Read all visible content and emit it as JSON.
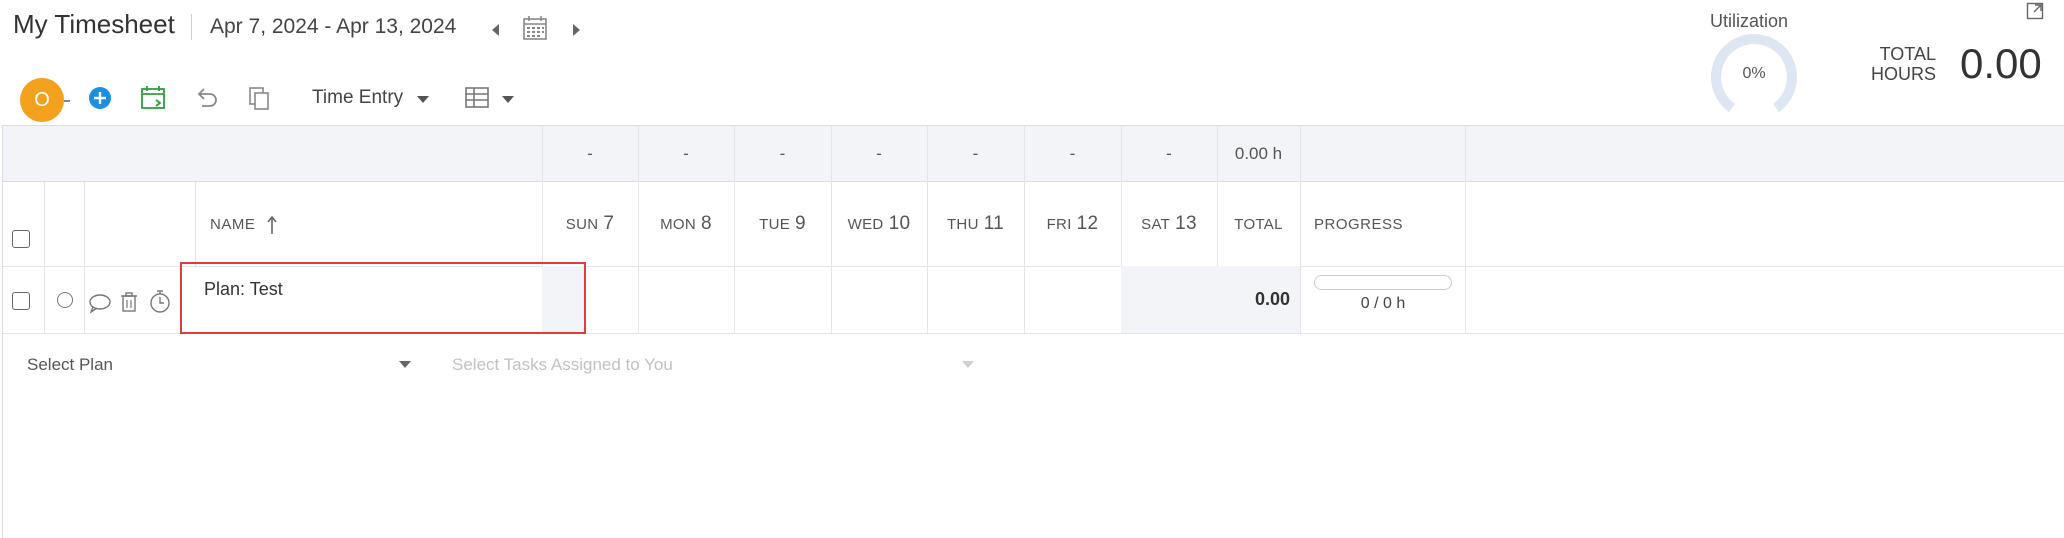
{
  "header": {
    "title": "My Timesheet",
    "date_range": "Apr 7, 2024 - Apr 13, 2024"
  },
  "utilization": {
    "label": "Utilization",
    "percent_text": "0%",
    "value": 0
  },
  "total_hours": {
    "label_line1": "TOTAL",
    "label_line2": "HOURS",
    "value": "0.00"
  },
  "toolbar": {
    "avatar_initial": "O",
    "view_mode": "Time Entry"
  },
  "summary_row": {
    "days": [
      "-",
      "-",
      "-",
      "-",
      "-",
      "-",
      "-"
    ],
    "total": "0.00 h"
  },
  "columns": {
    "name": "NAME",
    "days": [
      {
        "dow": "SUN",
        "num": "7"
      },
      {
        "dow": "MON",
        "num": "8"
      },
      {
        "dow": "TUE",
        "num": "9"
      },
      {
        "dow": "WED",
        "num": "10"
      },
      {
        "dow": "THU",
        "num": "11"
      },
      {
        "dow": "FRI",
        "num": "12"
      },
      {
        "dow": "SAT",
        "num": "13"
      }
    ],
    "total": "TOTAL",
    "progress": "PROGRESS"
  },
  "rows": [
    {
      "name": "Plan: Test",
      "total": "0.00",
      "progress_text": "0 / 0 h",
      "progress_value": 0
    }
  ],
  "selectors": {
    "plan_placeholder": "Select Plan",
    "tasks_placeholder": "Select Tasks Assigned to You"
  },
  "colors": {
    "avatar": "#f4a11e",
    "add_button": "#1a8fe3",
    "calendar_green": "#2e9e3f",
    "highlight_border": "#e03c3c",
    "shaded_cell": "#f3f4f8"
  }
}
